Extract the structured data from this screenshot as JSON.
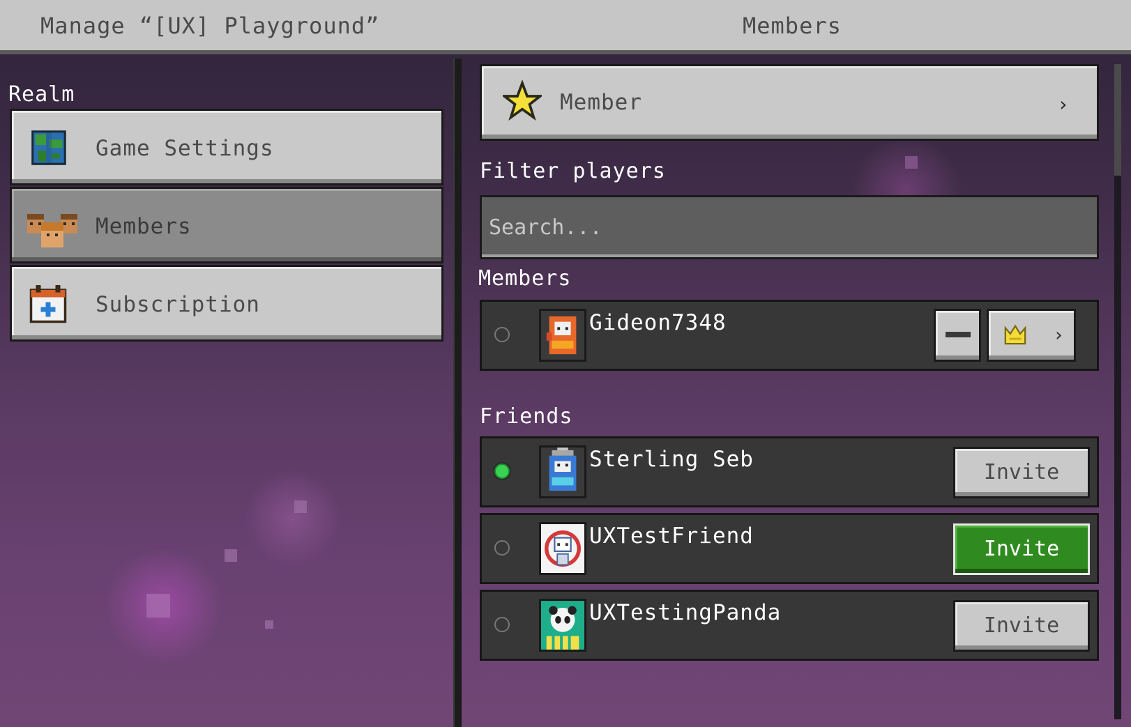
{
  "title_bar": {
    "left_title": "Manage “[UX] Playground”",
    "right_title": "Members"
  },
  "sidebar": {
    "section_label": "Realm",
    "items": [
      {
        "label": "Game Settings",
        "icon": "globe-icon",
        "selected": false
      },
      {
        "label": "Members",
        "icon": "members-icon",
        "selected": true
      },
      {
        "label": "Subscription",
        "icon": "calendar-plus-icon",
        "selected": false
      }
    ]
  },
  "main": {
    "role_selector": {
      "label": "Member",
      "icon": "star-icon",
      "chevron": "›"
    },
    "filter": {
      "label": "Filter players",
      "placeholder": "Search..."
    },
    "members_section": {
      "label": "Members",
      "rows": [
        {
          "name": "Gideon7348",
          "online": false,
          "avatar": "arcade-avatar-orange",
          "role_icon": "crown-icon",
          "chevron": "›"
        }
      ]
    },
    "friends_section": {
      "label": "Friends",
      "rows": [
        {
          "name": "Sterling Seb",
          "online": true,
          "avatar": "arcade-avatar-blue",
          "action": "Invite",
          "action_active": false
        },
        {
          "name": "UXTestFriend",
          "online": false,
          "avatar": "robot-avatar",
          "action": "Invite",
          "action_active": true
        },
        {
          "name": "UXTestingPanda",
          "online": false,
          "avatar": "panda-avatar",
          "action": "Invite",
          "action_active": false
        }
      ]
    }
  },
  "colors": {
    "button_gray": "#c9c9c9",
    "invite_active": "#2f8a1f",
    "online_dot": "#39d353",
    "background_top": "#2e2338",
    "background_bottom": "#704675"
  }
}
